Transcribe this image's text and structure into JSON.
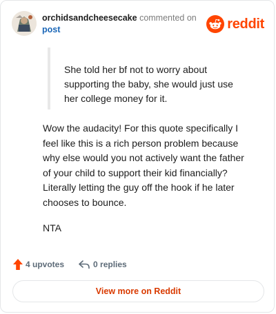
{
  "comment": {
    "username": "orchidsandcheesecake",
    "action_text": "commented on",
    "post_link": "post",
    "quote_lines": [
      "She told her bf not to worry about",
      "supporting the baby, she would just use",
      "her college money for it."
    ],
    "body_lines": [
      "Wow the audacity! For this quote specifically I",
      "feel like this is a rich person problem because",
      "why else would you not actively want the father",
      "of your child to support their kid financially?",
      "Literally letting the guy off the hook if he later",
      "chooses to bounce."
    ],
    "closing": "NTA"
  },
  "brand": {
    "name": "reddit",
    "color": "#ff4500"
  },
  "actions": {
    "upvotes": "4 upvotes",
    "replies": "0 replies",
    "upvote_color": "#ff4500"
  },
  "footer": {
    "view_button": "View more on Reddit"
  },
  "icons": {
    "avatar": "avatar",
    "brand": "reddit-logo-icon",
    "upvote": "upvote-arrow-icon",
    "reply": "reply-arrow-icon"
  }
}
